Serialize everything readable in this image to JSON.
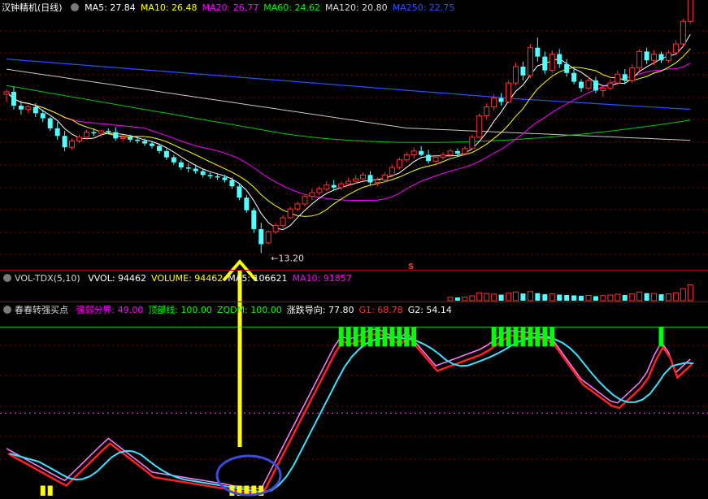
{
  "main_panel": {
    "title": "汉钟精机(日线)",
    "indicators": [
      {
        "label": "MA5: 27.84",
        "color": "#ffffff"
      },
      {
        "label": "MA10: 26.48",
        "color": "#ffff00"
      },
      {
        "label": "MA20: 26.77",
        "color": "#ff00ff"
      },
      {
        "label": "MA60: 24.62",
        "color": "#00ff00"
      },
      {
        "label": "MA120: 20.80",
        "color": "#dcdcdc"
      },
      {
        "label": "MA250: 22.75",
        "color": "#2a52ff"
      }
    ],
    "low_label": "13.20",
    "marker_label": "S"
  },
  "volume_panel": {
    "title": "VOL-TDX(5,10)",
    "indicators": [
      {
        "label": "VVOL: 94462",
        "color": "#ffffff"
      },
      {
        "label": "VOLUME: 94462",
        "color": "#ffff00"
      },
      {
        "label": "MA5: 106621",
        "color": "#ffffff"
      },
      {
        "label": "MA10: 91857",
        "color": "#ff00ff"
      }
    ]
  },
  "indicator_panel": {
    "title": "春春转强买点",
    "indicators": [
      {
        "label": "强弱分界: 49.00",
        "color": "#ff00ff"
      },
      {
        "label": "顶部线: 100.00",
        "color": "#00ff00"
      },
      {
        "label": "ZQDM: 100.00",
        "color": "#00ff00"
      },
      {
        "label": "涨跌导向: 77.80",
        "color": "#ffffff"
      },
      {
        "label": "G1: 68.78",
        "color": "#ff3030"
      },
      {
        "label": "G2: 54.14",
        "color": "#ffffff"
      }
    ]
  },
  "chart_data": {
    "type": "candlestick",
    "ylim": [
      12,
      32
    ],
    "candles": [
      [
        25.8,
        26.2,
        25.2,
        26.0
      ],
      [
        26.0,
        26.4,
        24.6,
        24.9
      ],
      [
        24.9,
        25.3,
        24.2,
        24.6
      ],
      [
        24.6,
        25.0,
        24.3,
        24.8
      ],
      [
        24.8,
        25.1,
        24.0,
        24.3
      ],
      [
        24.3,
        24.6,
        23.6,
        23.9
      ],
      [
        23.9,
        24.0,
        22.9,
        23.1
      ],
      [
        23.1,
        23.6,
        22.2,
        22.5
      ],
      [
        22.5,
        22.9,
        21.3,
        21.6
      ],
      [
        21.6,
        22.3,
        21.4,
        22.1
      ],
      [
        22.1,
        22.6,
        21.9,
        22.4
      ],
      [
        22.4,
        23.0,
        22.2,
        22.8
      ],
      [
        22.8,
        23.1,
        22.5,
        22.7
      ],
      [
        22.7,
        23.0,
        22.4,
        22.9
      ],
      [
        22.9,
        23.1,
        22.6,
        22.8
      ],
      [
        22.8,
        23.2,
        22.1,
        22.3
      ],
      [
        22.3,
        22.6,
        22.1,
        22.4
      ],
      [
        22.4,
        22.6,
        22.0,
        22.2
      ],
      [
        22.2,
        22.4,
        21.9,
        22.1
      ],
      [
        22.1,
        22.3,
        21.7,
        21.9
      ],
      [
        21.9,
        22.1,
        21.5,
        21.7
      ],
      [
        21.7,
        21.9,
        21.1,
        21.3
      ],
      [
        21.3,
        21.5,
        20.6,
        20.8
      ],
      [
        20.8,
        21.0,
        20.2,
        20.4
      ],
      [
        20.4,
        20.6,
        19.8,
        20.0
      ],
      [
        20.0,
        20.3,
        19.6,
        19.9
      ],
      [
        19.9,
        20.1,
        19.5,
        19.7
      ],
      [
        19.7,
        19.9,
        19.2,
        19.4
      ],
      [
        19.4,
        19.6,
        19.1,
        19.3
      ],
      [
        19.3,
        19.5,
        19.0,
        19.2
      ],
      [
        19.2,
        19.4,
        18.8,
        19.0
      ],
      [
        19.0,
        19.2,
        18.3,
        18.5
      ],
      [
        18.5,
        18.7,
        17.4,
        17.6
      ],
      [
        17.6,
        17.8,
        16.4,
        16.6
      ],
      [
        16.6,
        16.8,
        14.8,
        15.1
      ],
      [
        15.1,
        15.6,
        13.2,
        13.9
      ],
      [
        14.0,
        15.0,
        13.9,
        14.9
      ],
      [
        14.9,
        15.6,
        14.7,
        15.4
      ],
      [
        15.4,
        16.2,
        15.2,
        16.0
      ],
      [
        16.0,
        16.9,
        15.9,
        16.7
      ],
      [
        16.7,
        17.3,
        16.5,
        17.1
      ],
      [
        17.1,
        17.9,
        16.9,
        17.7
      ],
      [
        17.7,
        18.3,
        17.4,
        18.0
      ],
      [
        18.0,
        18.5,
        17.8,
        18.3
      ],
      [
        18.3,
        18.9,
        18.1,
        18.6
      ],
      [
        18.6,
        19.0,
        18.2,
        18.4
      ],
      [
        18.4,
        18.9,
        18.2,
        18.7
      ],
      [
        18.7,
        19.2,
        18.5,
        18.9
      ],
      [
        18.9,
        19.4,
        18.7,
        19.1
      ],
      [
        19.1,
        19.6,
        18.9,
        19.4
      ],
      [
        19.4,
        19.7,
        18.6,
        18.8
      ],
      [
        18.8,
        19.2,
        18.5,
        19.0
      ],
      [
        19.0,
        19.6,
        18.8,
        19.4
      ],
      [
        19.4,
        20.2,
        19.2,
        20.0
      ],
      [
        20.0,
        20.8,
        19.8,
        20.6
      ],
      [
        20.6,
        21.2,
        20.4,
        21.0
      ],
      [
        21.0,
        21.6,
        20.7,
        21.3
      ],
      [
        21.3,
        21.7,
        20.9,
        21.0
      ],
      [
        21.0,
        21.4,
        20.3,
        20.5
      ],
      [
        20.5,
        21.0,
        20.3,
        20.8
      ],
      [
        20.8,
        21.2,
        20.6,
        21.0
      ],
      [
        21.0,
        21.5,
        20.8,
        21.3
      ],
      [
        21.3,
        21.5,
        20.9,
        21.1
      ],
      [
        21.1,
        21.7,
        21.0,
        21.5
      ],
      [
        21.5,
        22.6,
        21.4,
        22.4
      ],
      [
        22.4,
        24.3,
        22.3,
        24.1
      ],
      [
        24.1,
        25.1,
        23.8,
        24.8
      ],
      [
        24.8,
        25.8,
        24.5,
        25.5
      ],
      [
        25.5,
        25.9,
        24.9,
        25.2
      ],
      [
        25.2,
        26.9,
        25.1,
        26.7
      ],
      [
        26.7,
        28.3,
        26.5,
        28.0
      ],
      [
        28.0,
        28.4,
        26.9,
        27.3
      ],
      [
        27.3,
        29.8,
        27.1,
        29.5
      ],
      [
        29.5,
        30.3,
        28.4,
        28.8
      ],
      [
        28.8,
        29.2,
        27.4,
        27.7
      ],
      [
        27.7,
        29.3,
        27.5,
        29.0
      ],
      [
        29.0,
        29.4,
        27.9,
        28.2
      ],
      [
        28.2,
        28.6,
        27.2,
        27.5
      ],
      [
        27.5,
        27.9,
        26.6,
        26.8
      ],
      [
        26.8,
        27.0,
        26.0,
        26.3
      ],
      [
        26.3,
        27.2,
        26.1,
        26.9
      ],
      [
        26.9,
        27.2,
        25.9,
        26.1
      ],
      [
        26.1,
        26.6,
        25.6,
        26.3
      ],
      [
        26.3,
        27.0,
        26.1,
        26.7
      ],
      [
        26.7,
        27.7,
        26.5,
        27.4
      ],
      [
        27.4,
        27.8,
        26.6,
        26.9
      ],
      [
        26.9,
        28.2,
        26.7,
        27.9
      ],
      [
        27.9,
        29.4,
        27.7,
        29.2
      ],
      [
        29.2,
        29.5,
        28.2,
        28.5
      ],
      [
        28.5,
        29.3,
        28.1,
        29.0
      ],
      [
        29.0,
        29.2,
        28.3,
        28.5
      ],
      [
        28.5,
        29.3,
        28.3,
        29.1
      ],
      [
        29.1,
        30.1,
        28.9,
        29.8
      ],
      [
        29.8,
        31.8,
        29.6,
        31.6
      ],
      [
        31.6,
        34.2,
        31.4,
        33.8
      ]
    ],
    "volume": [
      120,
      110,
      95,
      80,
      75,
      70,
      88,
      92,
      105,
      90,
      70,
      68,
      72,
      60,
      58,
      64,
      55,
      52,
      50,
      56,
      58,
      62,
      66,
      70,
      64,
      60,
      56,
      55,
      52,
      50,
      54,
      62,
      80,
      98,
      120,
      130,
      150,
      135,
      115,
      110,
      100,
      95,
      90,
      88,
      85,
      80,
      78,
      82,
      86,
      90,
      84,
      80,
      86,
      100,
      112,
      120,
      108,
      96,
      92,
      88,
      84,
      90,
      86,
      94,
      130,
      210,
      190,
      175,
      160,
      200,
      230,
      190,
      240,
      200,
      170,
      180,
      160,
      150,
      140,
      130,
      140,
      120,
      135,
      150,
      170,
      150,
      180,
      230,
      200,
      190,
      170,
      180,
      210,
      320,
      420
    ],
    "indicator_ylim": [
      0,
      105
    ],
    "indicator_top": 100,
    "indicator_mid": 49
  },
  "annotations": {
    "arrow": "yellow-up-arrow",
    "circle": "blue-ellipse"
  }
}
